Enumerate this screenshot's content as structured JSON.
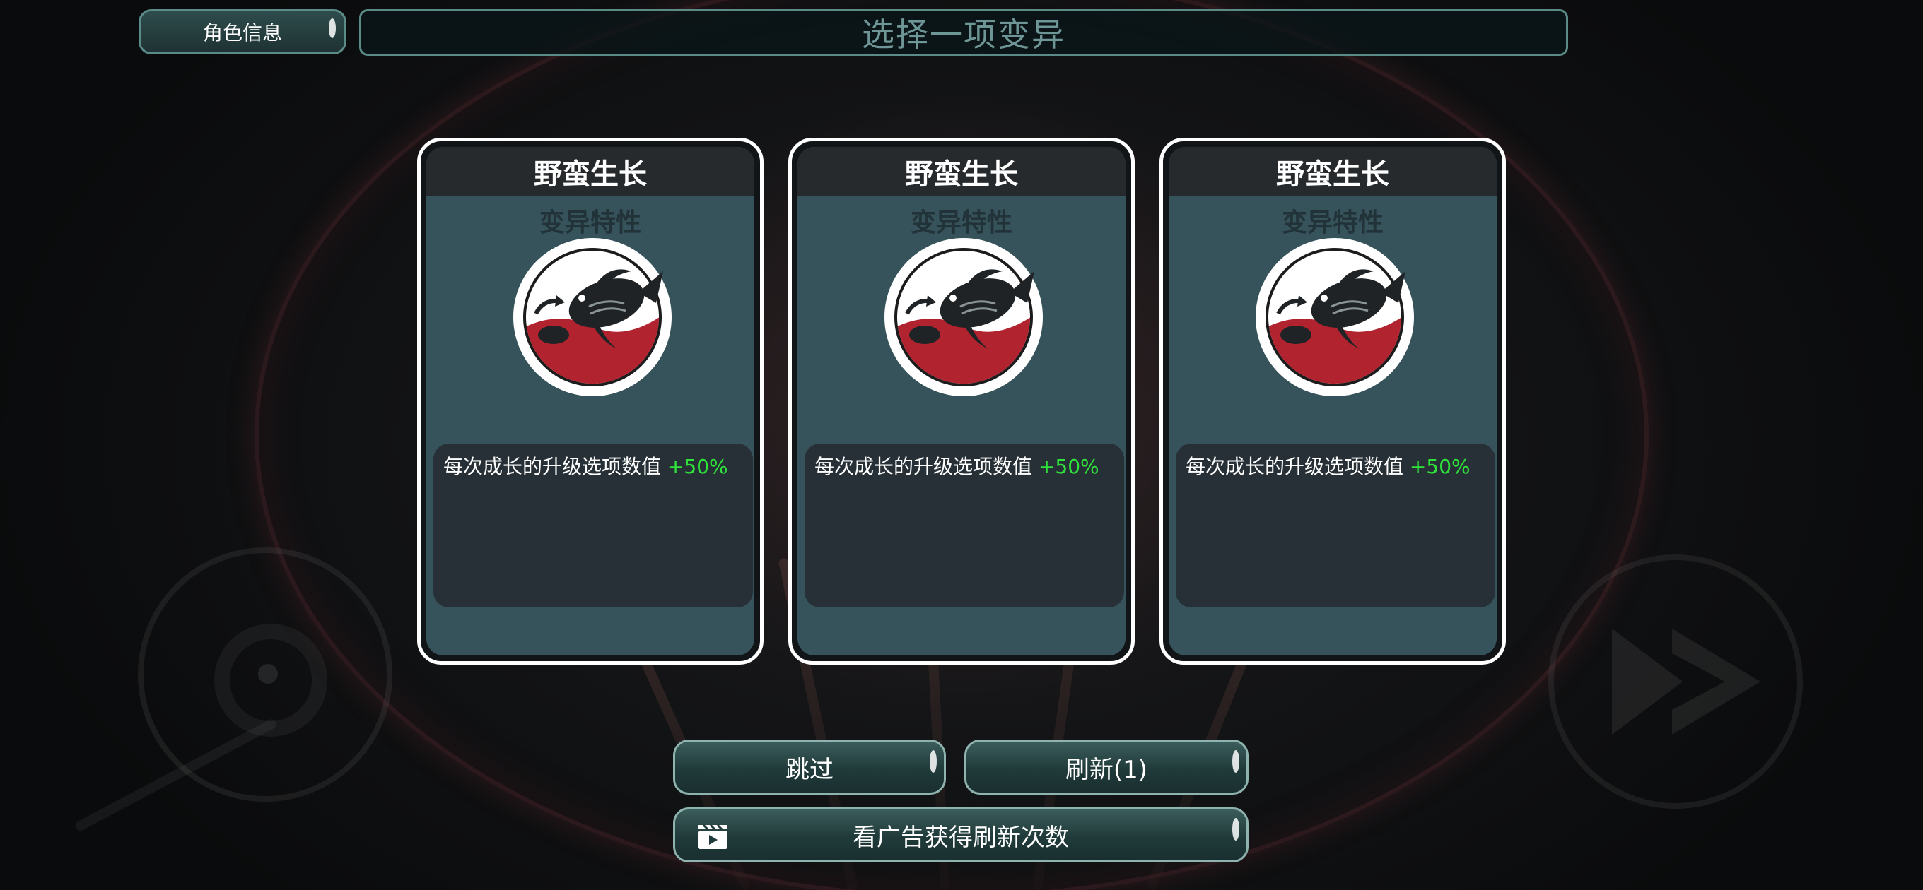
{
  "header": {
    "role_info_label": "角色信息",
    "title": "选择一项变异"
  },
  "cards": [
    {
      "name": "野蛮生长",
      "type": "变异特性",
      "icon": "fish-growth-icon",
      "desc_text": "每次成长的升级选项数值",
      "desc_bonus": "+50%"
    },
    {
      "name": "野蛮生长",
      "type": "变异特性",
      "icon": "fish-growth-icon",
      "desc_text": "每次成长的升级选项数值",
      "desc_bonus": "+50%"
    },
    {
      "name": "野蛮生长",
      "type": "变异特性",
      "icon": "fish-growth-icon",
      "desc_text": "每次成长的升级选项数值",
      "desc_bonus": "+50%"
    }
  ],
  "actions": {
    "skip_label": "跳过",
    "refresh_label": "刷新(1)",
    "watch_ad_label": "看广告获得刷新次数"
  },
  "colors": {
    "bonus_green": "#2fe33a",
    "card_body": "#36525a",
    "frame_teal": "#5b8b87",
    "icon_red": "#b0232f"
  }
}
